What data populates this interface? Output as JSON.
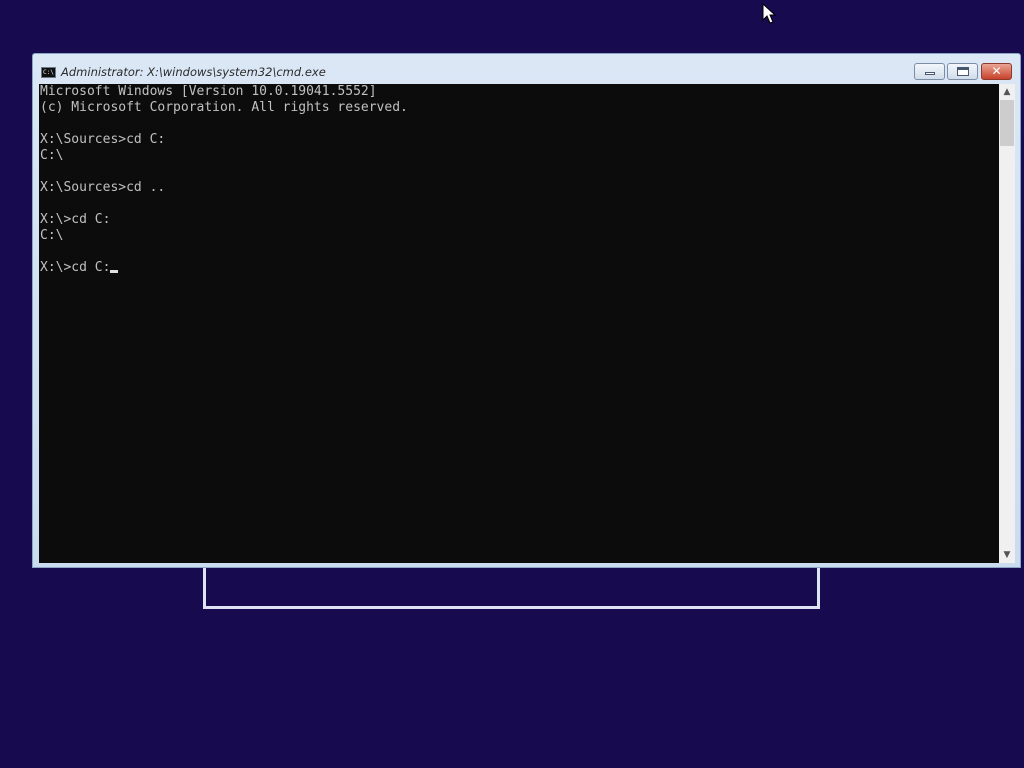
{
  "window": {
    "title": "Administrator: X:\\windows\\system32\\cmd.exe",
    "icon_text": "C:\\",
    "close_glyph": "✕"
  },
  "console": {
    "lines": [
      "Microsoft Windows [Version 10.0.19041.5552]",
      "(c) Microsoft Corporation. All rights reserved.",
      "",
      "X:\\Sources>cd C:",
      "C:\\",
      "",
      "X:\\Sources>cd ..",
      "",
      "X:\\>cd C:",
      "C:\\",
      "",
      "X:\\>cd C:"
    ]
  },
  "scrollbar": {
    "up_glyph": "▲",
    "down_glyph": "▼"
  },
  "colors": {
    "desktop_background": "#180a4f",
    "console_background": "#0c0c0c",
    "console_text": "#c0c0c0",
    "close_button": "#c8422b"
  },
  "icons": {
    "console_app": "cmd-icon",
    "minimize": "minimize-icon",
    "maximize": "maximize-icon",
    "close": "close-icon",
    "pointer": "mouse-pointer-icon"
  }
}
